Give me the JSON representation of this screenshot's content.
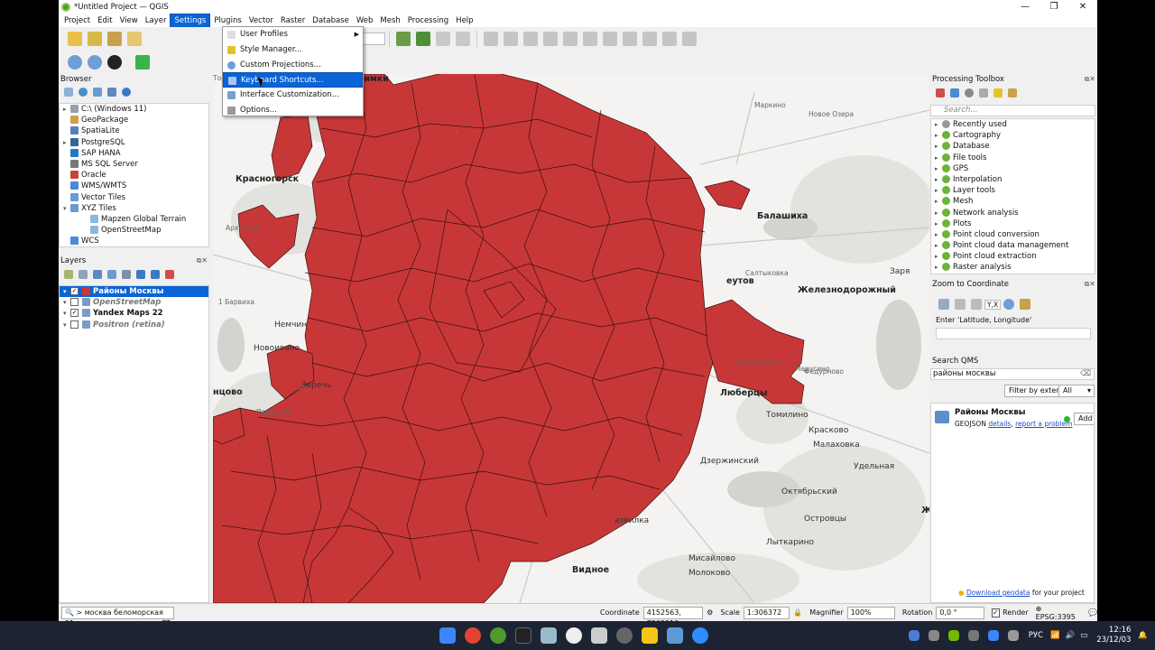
{
  "window": {
    "title": "*Untitled Project — QGIS",
    "minimize": "—",
    "maximize": "❐",
    "close": "✕"
  },
  "menubar": [
    "Project",
    "Edit",
    "View",
    "Layer",
    "Settings",
    "Plugins",
    "Vector",
    "Raster",
    "Database",
    "Web",
    "Mesh",
    "Processing",
    "Help"
  ],
  "settings_menu": [
    {
      "label": "User Profiles",
      "submenu": true
    },
    {
      "label": "Style Manager..."
    },
    {
      "label": "Custom Projections..."
    },
    {
      "label": "Keyboard Shortcuts...",
      "highlighted": true
    },
    {
      "label": "Interface Customization..."
    },
    {
      "label": "Options..."
    }
  ],
  "toolbar": {
    "font_size": "12",
    "unit": "px"
  },
  "browser": {
    "title": "Browser",
    "items": [
      {
        "label": "C:\\ (Windows 11)",
        "expand": "▸",
        "icon_color": "#9aa0a6"
      },
      {
        "label": "GeoPackage",
        "expand": "",
        "icon_color": "#c9a24a"
      },
      {
        "label": "SpatiaLite",
        "expand": "",
        "icon_color": "#5c7fb6"
      },
      {
        "label": "PostgreSQL",
        "expand": "▸",
        "icon_color": "#336791"
      },
      {
        "label": "SAP HANA",
        "expand": "",
        "icon_color": "#1f7ac9"
      },
      {
        "label": "MS SQL Server",
        "expand": "",
        "icon_color": "#777"
      },
      {
        "label": "Oracle",
        "expand": "",
        "icon_color": "#c74634"
      },
      {
        "label": "WMS/WMTS",
        "expand": "",
        "icon_color": "#4a8bd6"
      },
      {
        "label": "Vector Tiles",
        "expand": "",
        "icon_color": "#6a9bd1"
      },
      {
        "label": "XYZ Tiles",
        "expand": "▾",
        "icon_color": "#6a9bd1"
      },
      {
        "label": "Mapzen Global Terrain",
        "expand": "",
        "icon_color": "#8db7e0",
        "indent": true
      },
      {
        "label": "OpenStreetMap",
        "expand": "",
        "icon_color": "#8db7e0",
        "indent": true
      },
      {
        "label": "WCS",
        "expand": "",
        "icon_color": "#4a8bd6"
      }
    ]
  },
  "layers": {
    "title": "Layers",
    "items": [
      {
        "label": "Районы Москвы",
        "checked": true,
        "selected": true,
        "style": "bold",
        "swatch": "#c83737"
      },
      {
        "label": "OpenStreetMap",
        "checked": false,
        "selected": false,
        "style": "italic-bold-gray",
        "swatch": "#7a9cc6"
      },
      {
        "label": "Yandex Maps 22",
        "checked": true,
        "selected": false,
        "style": "bold",
        "swatch": "#7a9cc6"
      },
      {
        "label": "Positron (retina)",
        "checked": false,
        "selected": false,
        "style": "italic-bold-gray",
        "swatch": "#7a9cc6"
      }
    ]
  },
  "map_labels": [
    {
      "text": "Химки",
      "cls": "b"
    },
    {
      "text": "Путилко",
      "cls": ""
    },
    {
      "text": "Красногорск",
      "cls": "b"
    },
    {
      "text": "Архангел",
      "cls": "s"
    },
    {
      "text": "Немчин",
      "cls": ""
    },
    {
      "text": "Новоивано",
      "cls": ""
    },
    {
      "text": "нцово",
      "cls": "b"
    },
    {
      "text": "Передели",
      "cls": "s"
    },
    {
      "text": "Заречь",
      "cls": ""
    },
    {
      "text": "1 Барвиха",
      "cls": "s"
    },
    {
      "text": "Балашиха",
      "cls": "b"
    },
    {
      "text": "еутов",
      "cls": "b"
    },
    {
      "text": "Заря",
      "cls": ""
    },
    {
      "text": "Железнодорожный",
      "cls": "b"
    },
    {
      "text": "Салтыковка",
      "cls": "s"
    },
    {
      "text": "Люберцы",
      "cls": "b"
    },
    {
      "text": "Томилино",
      "cls": ""
    },
    {
      "text": "Красково",
      "cls": ""
    },
    {
      "text": "Малаховка",
      "cls": ""
    },
    {
      "text": "Дзержинский",
      "cls": ""
    },
    {
      "text": "Удельная",
      "cls": ""
    },
    {
      "text": "Октябрьский",
      "cls": ""
    },
    {
      "text": "Островцы",
      "cls": ""
    },
    {
      "text": "Лыткарино",
      "cls": ""
    },
    {
      "text": "Мисайлово",
      "cls": ""
    },
    {
      "text": "Молоково",
      "cls": ""
    },
    {
      "text": "Видное",
      "cls": "b"
    },
    {
      "text": "азвилка",
      "cls": ""
    },
    {
      "text": "Федурново",
      "cls": "s"
    },
    {
      "text": "Мосрентген",
      "cls": "s"
    },
    {
      "text": "Маркино",
      "cls": "s"
    },
    {
      "text": "Марусино",
      "cls": "s"
    },
    {
      "text": "Торбеево",
      "cls": "s"
    },
    {
      "text": "Жу",
      "cls": "b"
    },
    {
      "text": "Новое Озера",
      "cls": "s"
    }
  ],
  "processing": {
    "title": "Processing Toolbox",
    "search_placeholder": "Search...",
    "items": [
      "Recently used",
      "Cartography",
      "Database",
      "File tools",
      "GPS",
      "Interpolation",
      "Layer tools",
      "Mesh",
      "Network analysis",
      "Plots",
      "Point cloud conversion",
      "Point cloud data management",
      "Point cloud extraction",
      "Raster analysis"
    ]
  },
  "zoom_coord": {
    "title": "Zoom to Coordinate",
    "label": "Enter 'Latitude, Longitude'",
    "xy_btn": "Y,X"
  },
  "qms": {
    "title": "Search QMS",
    "query": "районы москвы",
    "filter_by_extent": "Filter by extent",
    "filter_all": "All",
    "result_title": "Районы Москвы",
    "result_type": "GEOJSON",
    "result_details": "details",
    "result_report": "report a problem",
    "add": "Add",
    "download_link": "Download geodata",
    "download_suffix": "for your project"
  },
  "status": {
    "locator": "> москва беломорская 21",
    "coordinate_label": "Coordinate",
    "coordinate": "4152563, 7502219",
    "scale_label": "Scale",
    "scale": "1:306372",
    "magnifier_label": "Magnifier",
    "magnifier": "100%",
    "rotation_label": "Rotation",
    "rotation": "0,0 °",
    "render_label": "Render",
    "crs": "EPSG:3395"
  },
  "taskbar": {
    "lang": "РУС",
    "time": "12:16",
    "date": "23/12/03"
  },
  "colors": {
    "district_fill": "#c83737",
    "district_stroke": "#3a1010",
    "selection": "#0a64d6"
  }
}
